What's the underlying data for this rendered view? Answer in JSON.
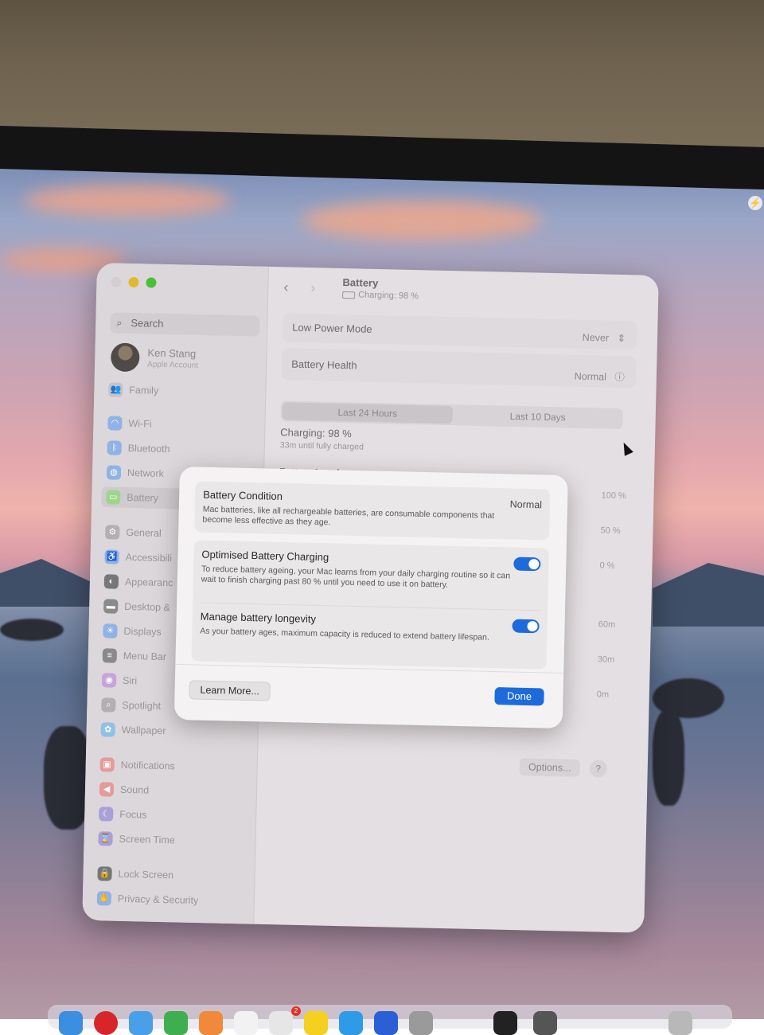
{
  "sidebar": {
    "search_placeholder": "Search",
    "account": {
      "name": "Ken Stang",
      "subtitle": "Apple Account"
    },
    "items": [
      {
        "label": "Family"
      },
      {
        "label": "Wi-Fi"
      },
      {
        "label": "Bluetooth"
      },
      {
        "label": "Network"
      },
      {
        "label": "Battery"
      },
      {
        "label": "General"
      },
      {
        "label": "Accessibili"
      },
      {
        "label": "Appearanc"
      },
      {
        "label": "Desktop &"
      },
      {
        "label": "Displays"
      },
      {
        "label": "Menu Bar"
      },
      {
        "label": "Siri"
      },
      {
        "label": "Spotlight"
      },
      {
        "label": "Wallpaper"
      },
      {
        "label": "Notifications"
      },
      {
        "label": "Sound"
      },
      {
        "label": "Focus"
      },
      {
        "label": "Screen Time"
      },
      {
        "label": "Lock Screen"
      },
      {
        "label": "Privacy & Security"
      }
    ]
  },
  "window": {
    "title": "Battery",
    "subtitle": "Charging: 98 %"
  },
  "battery": {
    "low_power_label": "Low Power Mode",
    "low_power_value": "Never",
    "health_label": "Battery Health",
    "health_value": "Normal",
    "tab_24h": "Last 24 Hours",
    "tab_10d": "Last 10 Days",
    "charging_status": "Charging: 98 %",
    "charging_eta": "33m until fully charged",
    "level_title": "Battery Level",
    "axis_level": [
      "100 %",
      "50 %",
      "0 %"
    ],
    "axis_time": [
      "60m",
      "30m",
      "0m"
    ],
    "options_label": "Options...",
    "help_label": "?"
  },
  "sheet": {
    "condition_title": "Battery Condition",
    "condition_value": "Normal",
    "condition_desc": "Mac batteries, like all rechargeable batteries, are consumable components that become less effective as they age.",
    "optimised_title": "Optimised Battery Charging",
    "optimised_desc": "To reduce battery ageing, your Mac learns from your daily charging routine so it can wait to finish charging past 80 % until you need to use it on battery.",
    "optimised_on": true,
    "longevity_title": "Manage battery longevity",
    "longevity_desc": "As your battery ages, maximum capacity is reduced to extend battery lifespan.",
    "longevity_on": true,
    "learn_more_label": "Learn More...",
    "done_label": "Done"
  },
  "dock": {
    "badge": "2"
  }
}
